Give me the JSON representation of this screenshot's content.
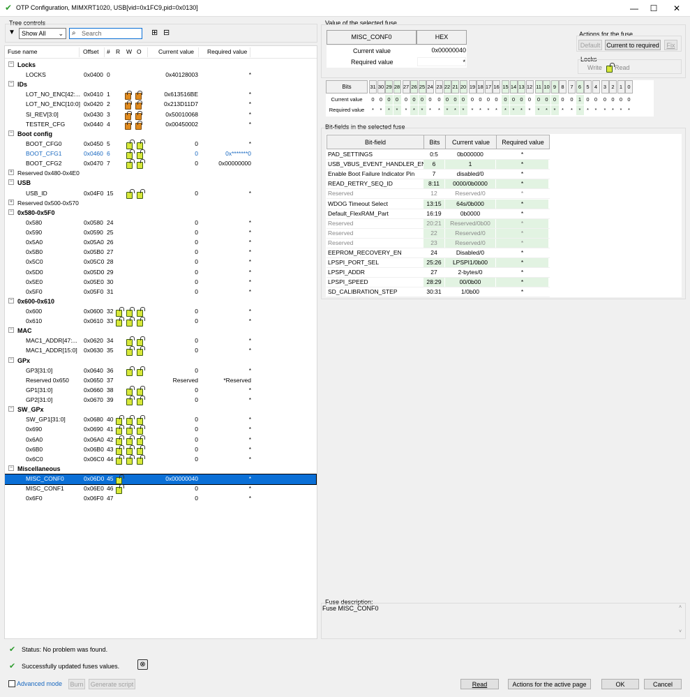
{
  "window": {
    "title": "OTP Configuration, MIMXRT1020, USB[vid=0x1FC9,pid=0x0130]",
    "minimize": "—",
    "maximize": "☐",
    "close": "✕"
  },
  "tree_controls": {
    "caption": "Tree controls",
    "filter_value": "Show All",
    "search_placeholder": "Search",
    "expand_glyph": "⊞",
    "collapse_glyph": "⊟"
  },
  "tree": {
    "headers": {
      "name": "Fuse name",
      "offset": "Offset",
      "num": "#",
      "r": "R",
      "w": "W",
      "o": "O",
      "current": "Current value",
      "required": "Required value"
    },
    "rows": [
      {
        "type": "cat",
        "name": "Locks",
        "exp": "−"
      },
      {
        "type": "fuse",
        "name": "LOCKS",
        "offset": "0x0400",
        "num": "0",
        "current": "0x40128003",
        "required": "*"
      },
      {
        "type": "cat",
        "name": "IDs",
        "exp": "−"
      },
      {
        "type": "fuse",
        "name": "LOT_NO_ENC[42:...",
        "offset": "0x0410",
        "num": "1",
        "locks": "closed",
        "current": "0x613516BE",
        "required": "*"
      },
      {
        "type": "fuse",
        "name": "LOT_NO_ENC[10:0]",
        "offset": "0x0420",
        "num": "2",
        "locks": "closed",
        "current": "0x213D11D7",
        "required": "*"
      },
      {
        "type": "fuse",
        "name": "SI_REV[3:0]",
        "offset": "0x0430",
        "num": "3",
        "locks": "closed",
        "current": "0x50010068",
        "required": "*"
      },
      {
        "type": "fuse",
        "name": "TESTER_CFG",
        "offset": "0x0440",
        "num": "4",
        "locks": "closed",
        "current": "0x00450002",
        "required": "*"
      },
      {
        "type": "cat",
        "name": "Boot config",
        "exp": "−"
      },
      {
        "type": "fuse",
        "name": "BOOT_CFG0",
        "offset": "0x0450",
        "num": "5",
        "locks": "open",
        "current": "0",
        "required": "*"
      },
      {
        "type": "fuse",
        "name": "BOOT_CFG1",
        "offset": "0x0460",
        "num": "6",
        "locks": "open",
        "current": "0",
        "required": "0x*******0",
        "blue": true
      },
      {
        "type": "fuse",
        "name": "BOOT_CFG2",
        "offset": "0x0470",
        "num": "7",
        "locks": "open",
        "current": "0",
        "required": "0x00000000"
      },
      {
        "type": "catplain",
        "name": "Reserved 0x480-0x4E0",
        "exp": "+"
      },
      {
        "type": "cat",
        "name": "USB",
        "exp": "−"
      },
      {
        "type": "fuse",
        "name": "USB_ID",
        "offset": "0x04F0",
        "num": "15",
        "locks": "open",
        "current": "0",
        "required": "*"
      },
      {
        "type": "catplain",
        "name": "Reserved 0x500-0x570",
        "exp": "+"
      },
      {
        "type": "cat",
        "name": "0x580-0x5F0",
        "exp": "−"
      },
      {
        "type": "fuse",
        "name": "0x580",
        "offset": "0x0580",
        "num": "24",
        "current": "0",
        "required": "*"
      },
      {
        "type": "fuse",
        "name": "0x590",
        "offset": "0x0590",
        "num": "25",
        "current": "0",
        "required": "*"
      },
      {
        "type": "fuse",
        "name": "0x5A0",
        "offset": "0x05A0",
        "num": "26",
        "current": "0",
        "required": "*"
      },
      {
        "type": "fuse",
        "name": "0x5B0",
        "offset": "0x05B0",
        "num": "27",
        "current": "0",
        "required": "*"
      },
      {
        "type": "fuse",
        "name": "0x5C0",
        "offset": "0x05C0",
        "num": "28",
        "current": "0",
        "required": "*"
      },
      {
        "type": "fuse",
        "name": "0x5D0",
        "offset": "0x05D0",
        "num": "29",
        "current": "0",
        "required": "*"
      },
      {
        "type": "fuse",
        "name": "0x5E0",
        "offset": "0x05E0",
        "num": "30",
        "current": "0",
        "required": "*"
      },
      {
        "type": "fuse",
        "name": "0x5F0",
        "offset": "0x05F0",
        "num": "31",
        "current": "0",
        "required": "*"
      },
      {
        "type": "cat",
        "name": "0x600-0x610",
        "exp": "−"
      },
      {
        "type": "fuse",
        "name": "0x600",
        "offset": "0x0600",
        "num": "32",
        "locks": "open3",
        "current": "0",
        "required": "*"
      },
      {
        "type": "fuse",
        "name": "0x610",
        "offset": "0x0610",
        "num": "33",
        "locks": "open3",
        "current": "0",
        "required": "*"
      },
      {
        "type": "cat",
        "name": "MAC",
        "exp": "−"
      },
      {
        "type": "fuse",
        "name": "MAC1_ADDR[47:...",
        "offset": "0x0620",
        "num": "34",
        "locks": "open",
        "current": "0",
        "required": "*"
      },
      {
        "type": "fuse",
        "name": "MAC1_ADDR[15:0]",
        "offset": "0x0630",
        "num": "35",
        "locks": "open",
        "current": "0",
        "required": "*"
      },
      {
        "type": "cat",
        "name": "GPx",
        "exp": "−"
      },
      {
        "type": "fuse",
        "name": "GP3[31:0]",
        "offset": "0x0640",
        "num": "36",
        "locks": "open",
        "current": "0",
        "required": "*"
      },
      {
        "type": "fuse",
        "name": "Reserved 0x650",
        "offset": "0x0650",
        "num": "37",
        "current": "Reserved",
        "required": "*Reserved"
      },
      {
        "type": "fuse",
        "name": "GP1[31:0]",
        "offset": "0x0660",
        "num": "38",
        "locks": "open",
        "current": "0",
        "required": "*"
      },
      {
        "type": "fuse",
        "name": "GP2[31:0]",
        "offset": "0x0670",
        "num": "39",
        "locks": "open",
        "current": "0",
        "required": "*"
      },
      {
        "type": "cat",
        "name": "SW_GPx",
        "exp": "−"
      },
      {
        "type": "fuse",
        "name": "SW_GP1[31:0]",
        "offset": "0x0680",
        "num": "40",
        "locks": "open3",
        "current": "0",
        "required": "*"
      },
      {
        "type": "fuse",
        "name": "0x690",
        "offset": "0x0690",
        "num": "41",
        "locks": "open3",
        "current": "0",
        "required": "*"
      },
      {
        "type": "fuse",
        "name": "0x6A0",
        "offset": "0x06A0",
        "num": "42",
        "locks": "open3",
        "current": "0",
        "required": "*"
      },
      {
        "type": "fuse",
        "name": "0x6B0",
        "offset": "0x06B0",
        "num": "43",
        "locks": "open3",
        "current": "0",
        "required": "*"
      },
      {
        "type": "fuse",
        "name": "0x6C0",
        "offset": "0x06C0",
        "num": "44",
        "locks": "open3",
        "current": "0",
        "required": "*"
      },
      {
        "type": "cat",
        "name": "Miscellaneous",
        "exp": "−"
      },
      {
        "type": "fuse",
        "name": "MISC_CONF0",
        "offset": "0x06D0",
        "num": "45",
        "locks": "open1",
        "current": "0x00000040",
        "required": "*",
        "selected": true
      },
      {
        "type": "fuse",
        "name": "MISC_CONF1",
        "offset": "0x06E0",
        "num": "46",
        "locks": "open1",
        "current": "0",
        "required": "*"
      },
      {
        "type": "fuse",
        "name": "0x6F0",
        "offset": "0x06F0",
        "num": "47",
        "current": "0",
        "required": "*"
      }
    ]
  },
  "selected": {
    "caption": "Value of the selected fuse",
    "name": "MISC_CONF0",
    "format": "HEX",
    "current_label": "Current value",
    "current_value": "0x00000040",
    "required_label": "Required value",
    "required_value": "*"
  },
  "actions": {
    "caption": "Actions for the fuse",
    "default": "Default",
    "current_to_required": "Current to required",
    "fix": "Fix",
    "locks_caption": "Locks",
    "write": "Write",
    "read": "Read"
  },
  "bits": {
    "labels": [
      "Bits",
      "Current value",
      "Required value"
    ],
    "numbers": [
      "31",
      "30",
      "29",
      "28",
      "27",
      "26",
      "25",
      "24",
      "23",
      "22",
      "21",
      "20",
      "19",
      "18",
      "17",
      "16",
      "15",
      "14",
      "13",
      "12",
      "11",
      "10",
      "9",
      "8",
      "7",
      "6",
      "5",
      "4",
      "3",
      "2",
      "1",
      "0"
    ],
    "current": [
      "0",
      "0",
      "0",
      "0",
      "0",
      "0",
      "0",
      "0",
      "0",
      "0",
      "0",
      "0",
      "0",
      "0",
      "0",
      "0",
      "0",
      "0",
      "0",
      "0",
      "0",
      "0",
      "0",
      "0",
      "0",
      "1",
      "0",
      "0",
      "0",
      "0",
      "0",
      "0"
    ],
    "required": [
      "*",
      "*",
      "*",
      "*",
      "*",
      "*",
      "*",
      "*",
      "*",
      "*",
      "*",
      "*",
      "*",
      "*",
      "*",
      "*",
      "*",
      "*",
      "*",
      "*",
      "*",
      "*",
      "*",
      "*",
      "*",
      "*",
      "*",
      "*",
      "*",
      "*",
      "*",
      "*"
    ],
    "green_bits": [
      29,
      28,
      26,
      25,
      22,
      21,
      20,
      15,
      14,
      13,
      11,
      10,
      9,
      6
    ]
  },
  "bitfields": {
    "caption": "Bit-fields in the selected fuse",
    "headers": {
      "field": "Bit-field",
      "bits": "Bits",
      "current": "Current value",
      "required": "Required value"
    },
    "rows": [
      {
        "field": "PAD_SETTINGS",
        "bits": "0:5",
        "current": "0b000000",
        "required": "*"
      },
      {
        "field": "USB_VBUS_EVENT_HANDLER_EN",
        "bits": "6",
        "current": "1",
        "required": "*",
        "green": true
      },
      {
        "field": "Enable Boot Failure Indicator Pin",
        "bits": "7",
        "current": "disabled/0",
        "required": "*"
      },
      {
        "field": "READ_RETRY_SEQ_ID",
        "bits": "8:11",
        "current": "0000/0b0000",
        "required": "*",
        "green": true
      },
      {
        "field": "Reserved",
        "bits": "12",
        "current": "Reserved/0",
        "required": "*",
        "res": true
      },
      {
        "field": "WDOG Timeout Select",
        "bits": "13:15",
        "current": "64s/0b000",
        "required": "*",
        "green": true
      },
      {
        "field": "Default_FlexRAM_Part",
        "bits": "16:19",
        "current": "0b0000",
        "required": "*"
      },
      {
        "field": "Reserved",
        "bits": "20:21",
        "current": "Reserved/0b00",
        "required": "*",
        "res": true,
        "green": true
      },
      {
        "field": "Reserved",
        "bits": "22",
        "current": "Reserved/0",
        "required": "*",
        "res": true,
        "green": true
      },
      {
        "field": "Reserved",
        "bits": "23",
        "current": "Reserved/0",
        "required": "*",
        "res": true,
        "green": true
      },
      {
        "field": "EEPROM_RECOVERY_EN",
        "bits": "24",
        "current": "Disabled/0",
        "required": "*"
      },
      {
        "field": "LPSPI_PORT_SEL",
        "bits": "25:26",
        "current": "LPSPI1/0b00",
        "required": "*",
        "green": true
      },
      {
        "field": "LPSPI_ADDR",
        "bits": "27",
        "current": "2-bytes/0",
        "required": "*"
      },
      {
        "field": "LPSPI_SPEED",
        "bits": "28:29",
        "current": "00/0b00",
        "required": "*",
        "green": true
      },
      {
        "field": "SD_CALIBRATION_STEP",
        "bits": "30:31",
        "current": "1/0b00",
        "required": "*"
      }
    ]
  },
  "description": {
    "caption": "Fuse description:",
    "text": "Fuse MISC_CONF0"
  },
  "status": {
    "line1": "Status: No problem was found.",
    "line2": "Successfully updated fuses values."
  },
  "bottom": {
    "advanced": "Advanced mode",
    "burn": "Burn",
    "generate": "Generate script",
    "read": "Read",
    "actions_page": "Actions for the active page",
    "ok": "OK",
    "cancel": "Cancel"
  }
}
